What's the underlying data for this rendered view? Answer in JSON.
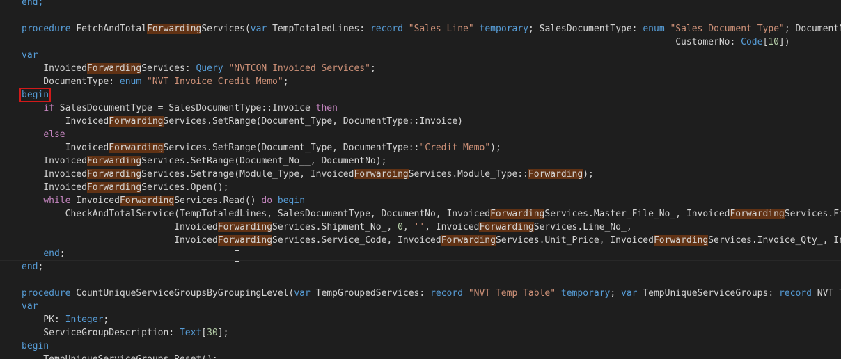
{
  "editor": {
    "highlight_term": "Forwarding",
    "lines": [
      "end;",
      "",
      "procedure FetchAndTotalForwardingServices(var TempTotaledLines: record \"Sales Line\" temporary; SalesDocumentType: enum \"Sales Document Type\"; DocumentNo",
      "                                                                                                                        CustomerNo: Code[10])",
      "var",
      "    InvoicedForwardingServices: Query \"NVTCON Invoiced Services\";",
      "    DocumentType: enum \"NVT Invoice Credit Memo\";",
      "begin",
      "    if SalesDocumentType = SalesDocumentType::Invoice then",
      "        InvoicedForwardingServices.SetRange(Document_Type, DocumentType::Invoice)",
      "    else",
      "        InvoicedForwardingServices.SetRange(Document_Type, DocumentType::\"Credit Memo\");",
      "    InvoicedForwardingServices.SetRange(Document_No__, DocumentNo);",
      "    InvoicedForwardingServices.Setrange(Module_Type, InvoicedForwardingServices.Module_Type::Forwarding);",
      "    InvoicedForwardingServices.Open();",
      "    while InvoicedForwardingServices.Read() do begin",
      "        CheckAndTotalService(TempTotaledLines, SalesDocumentType, DocumentNo, InvoicedForwardingServices.Master_File_No_, InvoicedForwardingServices.Fil",
      "                            InvoicedForwardingServices.Shipment_No_, 0, '', InvoicedForwardingServices.Line_No_,",
      "                            InvoicedForwardingServices.Service_Code, InvoicedForwardingServices.Unit_Price, InvoicedForwardingServices.Invoice_Qty_, Inv",
      "    end;",
      "end;",
      "",
      "procedure CountUniqueServiceGroupsByGroupingLevel(var TempGroupedServices: record \"NVT Temp Table\" temporary; var TempUniqueServiceGroups: record \"NVT T",
      "var",
      "    PK: Integer;",
      "    ServiceGroupDescription: Text[30];",
      "begin",
      "    TempUniqueServiceGroups.Reset();"
    ]
  }
}
